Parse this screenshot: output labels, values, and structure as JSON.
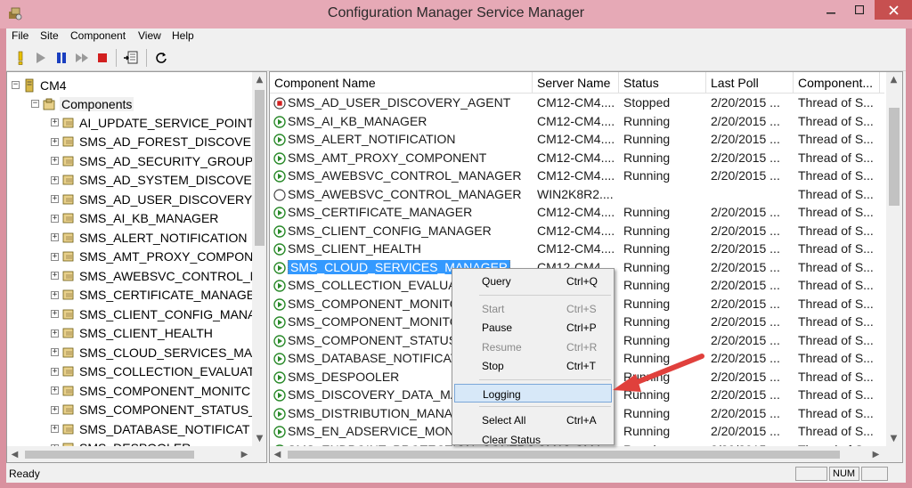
{
  "window": {
    "title": "Configuration Manager Service Manager"
  },
  "menubar": [
    "File",
    "Site",
    "Component",
    "View",
    "Help"
  ],
  "tree": {
    "root": "CM4",
    "folder": "Components",
    "items": [
      "AI_UPDATE_SERVICE_POINT",
      "SMS_AD_FOREST_DISCOVER",
      "SMS_AD_SECURITY_GROUP_",
      "SMS_AD_SYSTEM_DISCOVER",
      "SMS_AD_USER_DISCOVERY_",
      "SMS_AI_KB_MANAGER",
      "SMS_ALERT_NOTIFICATION",
      "SMS_AMT_PROXY_COMPON",
      "SMS_AWEBSVC_CONTROL_M",
      "SMS_CERTIFICATE_MANAGE",
      "SMS_CLIENT_CONFIG_MANA",
      "SMS_CLIENT_HEALTH",
      "SMS_CLOUD_SERVICES_MAN",
      "SMS_COLLECTION_EVALUAT",
      "SMS_COMPONENT_MONITC",
      "SMS_COMPONENT_STATUS_",
      "SMS_DATABASE_NOTIFICAT",
      "SMS_DESPOOLER"
    ]
  },
  "list": {
    "columns": [
      "Component Name",
      "Server Name",
      "Status",
      "Last Poll",
      "Component..."
    ],
    "rows": [
      {
        "name": "SMS_AD_USER_DISCOVERY_AGENT",
        "server": "CM12-CM4....",
        "status": "Stopped",
        "poll": "2/20/2015 ...",
        "type": "Thread of S...",
        "icon": "stopped"
      },
      {
        "name": "SMS_AI_KB_MANAGER",
        "server": "CM12-CM4....",
        "status": "Running",
        "poll": "2/20/2015 ...",
        "type": "Thread of S...",
        "icon": "running"
      },
      {
        "name": "SMS_ALERT_NOTIFICATION",
        "server": "CM12-CM4....",
        "status": "Running",
        "poll": "2/20/2015 ...",
        "type": "Thread of S...",
        "icon": "running"
      },
      {
        "name": "SMS_AMT_PROXY_COMPONENT",
        "server": "CM12-CM4....",
        "status": "Running",
        "poll": "2/20/2015 ...",
        "type": "Thread of S...",
        "icon": "running"
      },
      {
        "name": "SMS_AWEBSVC_CONTROL_MANAGER",
        "server": "CM12-CM4....",
        "status": "Running",
        "poll": "2/20/2015 ...",
        "type": "Thread of S...",
        "icon": "running"
      },
      {
        "name": "SMS_AWEBSVC_CONTROL_MANAGER",
        "server": "WIN2K8R2....",
        "status": "",
        "poll": "",
        "type": "Thread of S...",
        "icon": "unknown"
      },
      {
        "name": "SMS_CERTIFICATE_MANAGER",
        "server": "CM12-CM4....",
        "status": "Running",
        "poll": "2/20/2015 ...",
        "type": "Thread of S...",
        "icon": "running"
      },
      {
        "name": "SMS_CLIENT_CONFIG_MANAGER",
        "server": "CM12-CM4....",
        "status": "Running",
        "poll": "2/20/2015 ...",
        "type": "Thread of S...",
        "icon": "running"
      },
      {
        "name": "SMS_CLIENT_HEALTH",
        "server": "CM12-CM4....",
        "status": "Running",
        "poll": "2/20/2015 ...",
        "type": "Thread of S...",
        "icon": "running"
      },
      {
        "name": "SMS_CLOUD_SERVICES_MANAGER",
        "server": "CM12-CM4....",
        "status": "Running",
        "poll": "2/20/2015 ...",
        "type": "Thread of S...",
        "icon": "running",
        "selected": true
      },
      {
        "name": "SMS_COLLECTION_EVALUAT",
        "server": "",
        "status": "Running",
        "poll": "2/20/2015 ...",
        "type": "Thread of S...",
        "icon": "running"
      },
      {
        "name": "SMS_COMPONENT_MONITO",
        "server": "",
        "status": "Running",
        "poll": "2/20/2015 ...",
        "type": "Thread of S...",
        "icon": "running"
      },
      {
        "name": "SMS_COMPONENT_MONITO",
        "server": "",
        "status": "Running",
        "poll": "2/20/2015 ...",
        "type": "Thread of S...",
        "icon": "running"
      },
      {
        "name": "SMS_COMPONENT_STATUS_",
        "server": "",
        "status": "Running",
        "poll": "2/20/2015 ...",
        "type": "Thread of S...",
        "icon": "running"
      },
      {
        "name": "SMS_DATABASE_NOTIFICAT",
        "server": "",
        "status": "Running",
        "poll": "2/20/2015 ...",
        "type": "Thread of S...",
        "icon": "running"
      },
      {
        "name": "SMS_DESPOOLER",
        "server": "",
        "status": "Running",
        "poll": "2/20/2015 ...",
        "type": "Thread of S...",
        "icon": "running"
      },
      {
        "name": "SMS_DISCOVERY_DATA_MA",
        "server": "",
        "status": "Running",
        "poll": "2/20/2015 ...",
        "type": "Thread of S...",
        "icon": "running"
      },
      {
        "name": "SMS_DISTRIBUTION_MANAG",
        "server": "",
        "status": "Running",
        "poll": "2/20/2015 ...",
        "type": "Thread of S...",
        "icon": "running"
      },
      {
        "name": "SMS_EN_ADSERVICE_MONIT",
        "server": "",
        "status": "Running",
        "poll": "2/20/2015 ...",
        "type": "Thread of S...",
        "icon": "running"
      },
      {
        "name": "SMS_ENDPOINT_PROTECTION_CONTRO...",
        "server": "CM12-CM4....",
        "status": "Running",
        "poll": "2/20/2015 ...",
        "type": "Thread of S...",
        "icon": "running"
      }
    ]
  },
  "context_menu": [
    {
      "label": "Query",
      "shortcut": "Ctrl+Q",
      "disabled": false
    },
    {
      "sep": true
    },
    {
      "label": "Start",
      "shortcut": "Ctrl+S",
      "disabled": true
    },
    {
      "label": "Pause",
      "shortcut": "Ctrl+P",
      "disabled": false
    },
    {
      "label": "Resume",
      "shortcut": "Ctrl+R",
      "disabled": true
    },
    {
      "label": "Stop",
      "shortcut": "Ctrl+T",
      "disabled": false
    },
    {
      "sep": true
    },
    {
      "label": "Logging",
      "shortcut": "",
      "disabled": false,
      "highlight": true
    },
    {
      "sep": true
    },
    {
      "label": "Select All",
      "shortcut": "Ctrl+A",
      "disabled": false
    },
    {
      "label": "Clear Status",
      "shortcut": "",
      "disabled": false
    }
  ],
  "statusbar": {
    "text": "Ready",
    "num": "NUM"
  },
  "colors": {
    "running": "#2a8a2a",
    "stopped": "#d21f1f",
    "selection": "#3399ff",
    "arrow": "#e0403c"
  }
}
